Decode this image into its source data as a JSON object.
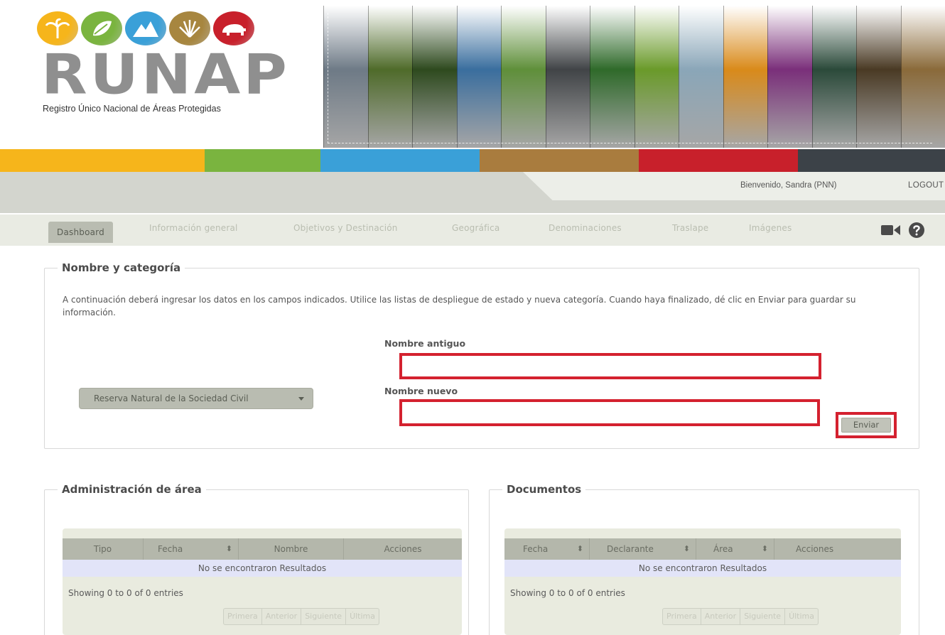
{
  "header": {
    "brand": "RUNAP",
    "tagline": "Registro Único Nacional de Áreas Protegidas",
    "logo_icons": [
      "palm-tree-icon",
      "leaf-icon",
      "mountain-icon",
      "grass-icon",
      "bear-icon"
    ],
    "logo_colors": [
      "#f6b51b",
      "#7ab43f",
      "#3aa0d8",
      "#a7863f",
      "#c8202b"
    ],
    "banner_colors": [
      "#6e7a86",
      "#4f6b2a",
      "#2e4a1e",
      "#3a6e9e",
      "#5f8f3a",
      "#414447",
      "#2f6a2a",
      "#6a9a2a",
      "#8aa6b8",
      "#d98a1a",
      "#7a2f7a",
      "#2b4a3a",
      "#4a3a24",
      "#8a6a3a"
    ],
    "color_bar": [
      "#f6b51b",
      "#7ab43f",
      "#3aa0d8",
      "#a97c3e",
      "#c8202b",
      "#3c4248"
    ]
  },
  "user_bar": {
    "welcome": "Bienvenido, Sandra (PNN)",
    "logout": "LOGOUT"
  },
  "nav": {
    "tabs": [
      {
        "label": "Dashboard"
      },
      {
        "label": "Información general"
      },
      {
        "label": "Objetivos y Destinación"
      },
      {
        "label": "Geográfica"
      },
      {
        "label": "Denominaciones"
      },
      {
        "label": "Traslape"
      },
      {
        "label": "Imágenes"
      }
    ],
    "icons": [
      "video-camera-icon",
      "help-icon"
    ]
  },
  "name_panel": {
    "legend": "Nombre y categoría",
    "intro": "A continuación deberá ingresar los datos en los campos indicados. Utilice las listas de despliegue de estado y nueva categoría. Cuando haya finalizado, dé clic en Enviar para guardar su información.",
    "old_name_label": "Nombre antiguo",
    "old_name_value": "",
    "new_name_label": "Nombre nuevo",
    "new_name_value": "",
    "category_selected": "Reserva Natural de la Sociedad Civil",
    "submit_label": "Enviar"
  },
  "admin_panel": {
    "legend": "Administración de área",
    "columns": [
      "Tipo",
      "Fecha",
      "Nombre",
      "Acciones"
    ],
    "empty_text": "No se encontraron Resultados",
    "showing": "Showing 0 to 0 of 0 entries",
    "pager": [
      "Primera",
      "Anterior",
      "Siguiente",
      "Última"
    ]
  },
  "docs_panel": {
    "legend": "Documentos",
    "columns": [
      "Fecha",
      "Declarante",
      "Área",
      "Acciones"
    ],
    "empty_text": "No se encontraron Resultados",
    "showing": "Showing 0 to 0 of 0 entries",
    "pager": [
      "Primera",
      "Anterior",
      "Siguiente",
      "Última"
    ]
  }
}
